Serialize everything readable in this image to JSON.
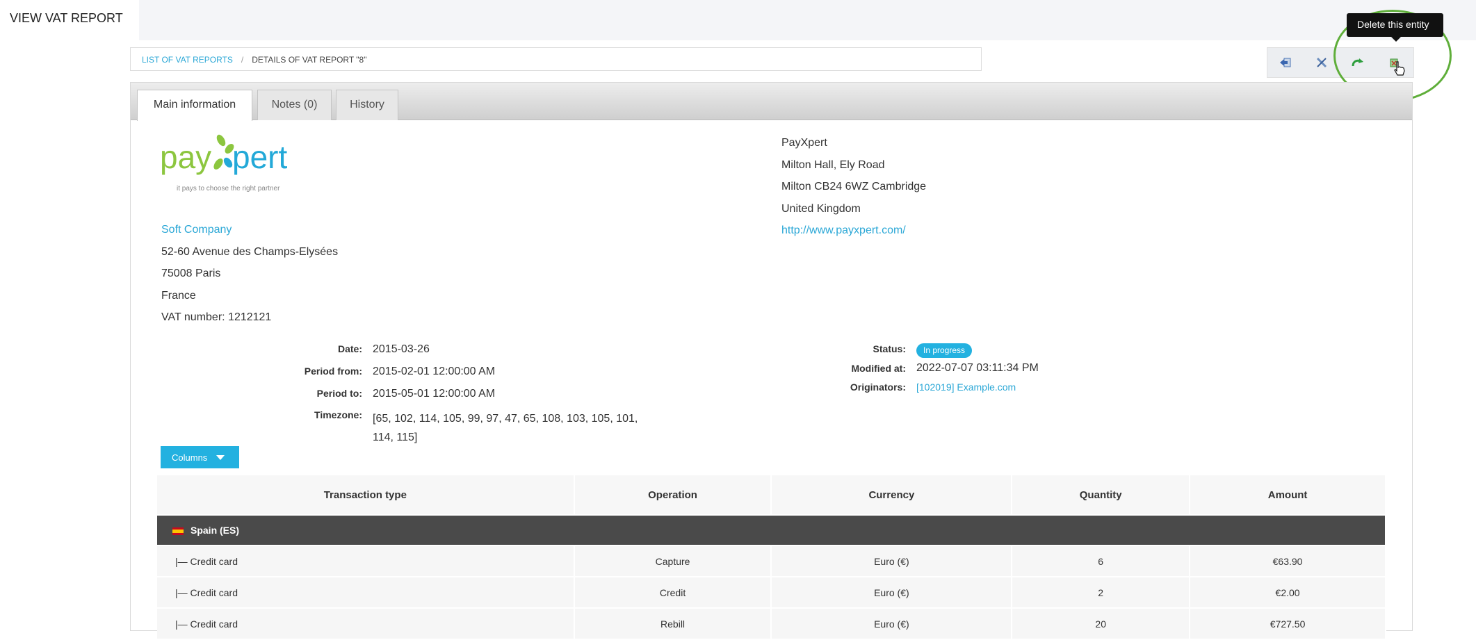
{
  "page": {
    "title": "VIEW VAT REPORT"
  },
  "breadcrumb": {
    "list_link": "LIST OF VAT REPORTS",
    "separator": "/",
    "current": "DETAILS OF VAT REPORT \"8\""
  },
  "toolbar": {
    "buttons": [
      {
        "icon": "back-icon"
      },
      {
        "icon": "tools-icon"
      },
      {
        "icon": "refresh-icon"
      },
      {
        "icon": "delete-icon"
      }
    ],
    "tooltip": "Delete this entity",
    "colors": {
      "accent": "#23b1e0",
      "highlight": "#5fae3a"
    }
  },
  "tabs": [
    {
      "label": "Main information",
      "active": true
    },
    {
      "label": "Notes (0)",
      "active": false
    },
    {
      "label": "History",
      "active": false
    }
  ],
  "logo": {
    "brand_left": "pay",
    "brand_right": "pert",
    "tagline": "it pays to choose the right partner"
  },
  "customer": {
    "name": "Soft Company",
    "street": "52-60 Avenue des Champs-Elysées",
    "city": "75008 Paris",
    "country": "France",
    "vat": "VAT number: 1212121"
  },
  "company": {
    "name": "PayXpert",
    "street": "Milton Hall, Ely Road",
    "city": "Milton CB24 6WZ Cambridge",
    "country": "United Kingdom",
    "url": "http://www.payxpert.com/"
  },
  "details_left": {
    "date_label": "Date:",
    "date": "2015-03-26",
    "period_from_label": "Period from:",
    "period_from": "2015-02-01 12:00:00 AM",
    "period_to_label": "Period to:",
    "period_to": "2015-05-01 12:00:00 AM",
    "timezone_label": "Timezone:",
    "timezone_line1": "[65, 102, 114, 105, 99, 97, 47, 65, 108, 103, 105, 101,",
    "timezone_line2": "114, 115]"
  },
  "details_right": {
    "status_label": "Status:",
    "status": "In progress",
    "modified_label": "Modified at:",
    "modified": "2022-07-07 03:11:34 PM",
    "originators_label": "Originators:",
    "originators": "[102019] Example.com"
  },
  "columns_button": "Columns",
  "table": {
    "headers": [
      "Transaction type",
      "Operation",
      "Currency",
      "Quantity",
      "Amount"
    ],
    "group": "Spain (ES)",
    "rows": [
      {
        "type": "|— Credit card",
        "operation": "Capture",
        "currency": "Euro (€)",
        "quantity": "6",
        "amount": "€63.90"
      },
      {
        "type": "|— Credit card",
        "operation": "Credit",
        "currency": "Euro (€)",
        "quantity": "2",
        "amount": "€2.00"
      },
      {
        "type": "|— Credit card",
        "operation": "Rebill",
        "currency": "Euro (€)",
        "quantity": "20",
        "amount": "€727.50"
      }
    ]
  }
}
